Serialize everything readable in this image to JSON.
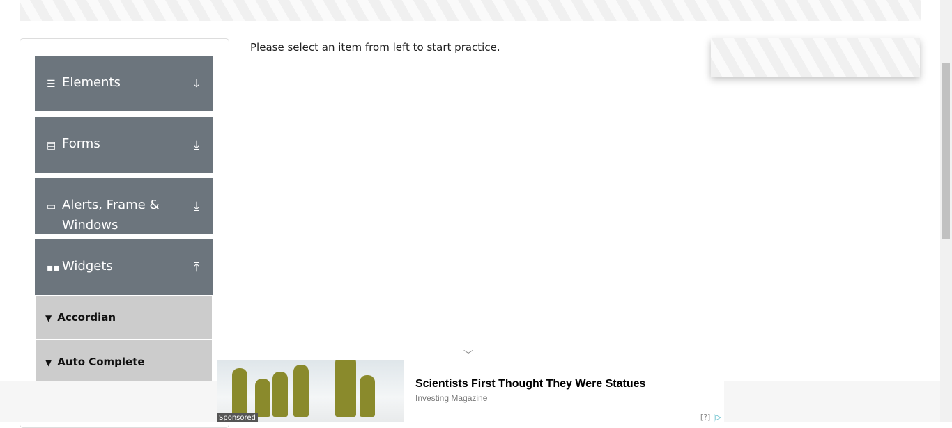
{
  "sidebar": {
    "groups": [
      {
        "label": "Elements",
        "icon": "hamburger-icon",
        "expanded": false
      },
      {
        "label": "Forms",
        "icon": "document-icon",
        "expanded": false
      },
      {
        "label": "Alerts, Frame & Windows",
        "icon": "window-icon",
        "expanded": false
      },
      {
        "label": "Widgets",
        "icon": "widgets-icon",
        "expanded": true
      }
    ],
    "items": [
      {
        "label": "Accordian"
      },
      {
        "label": "Auto Complete"
      }
    ]
  },
  "main": {
    "message": "Please select an item from left to start practice."
  },
  "ad": {
    "title": "Scientists First Thought They Were Statues",
    "source": "Investing Magazine",
    "sponsored": "Sponsored",
    "info": "[?]"
  }
}
